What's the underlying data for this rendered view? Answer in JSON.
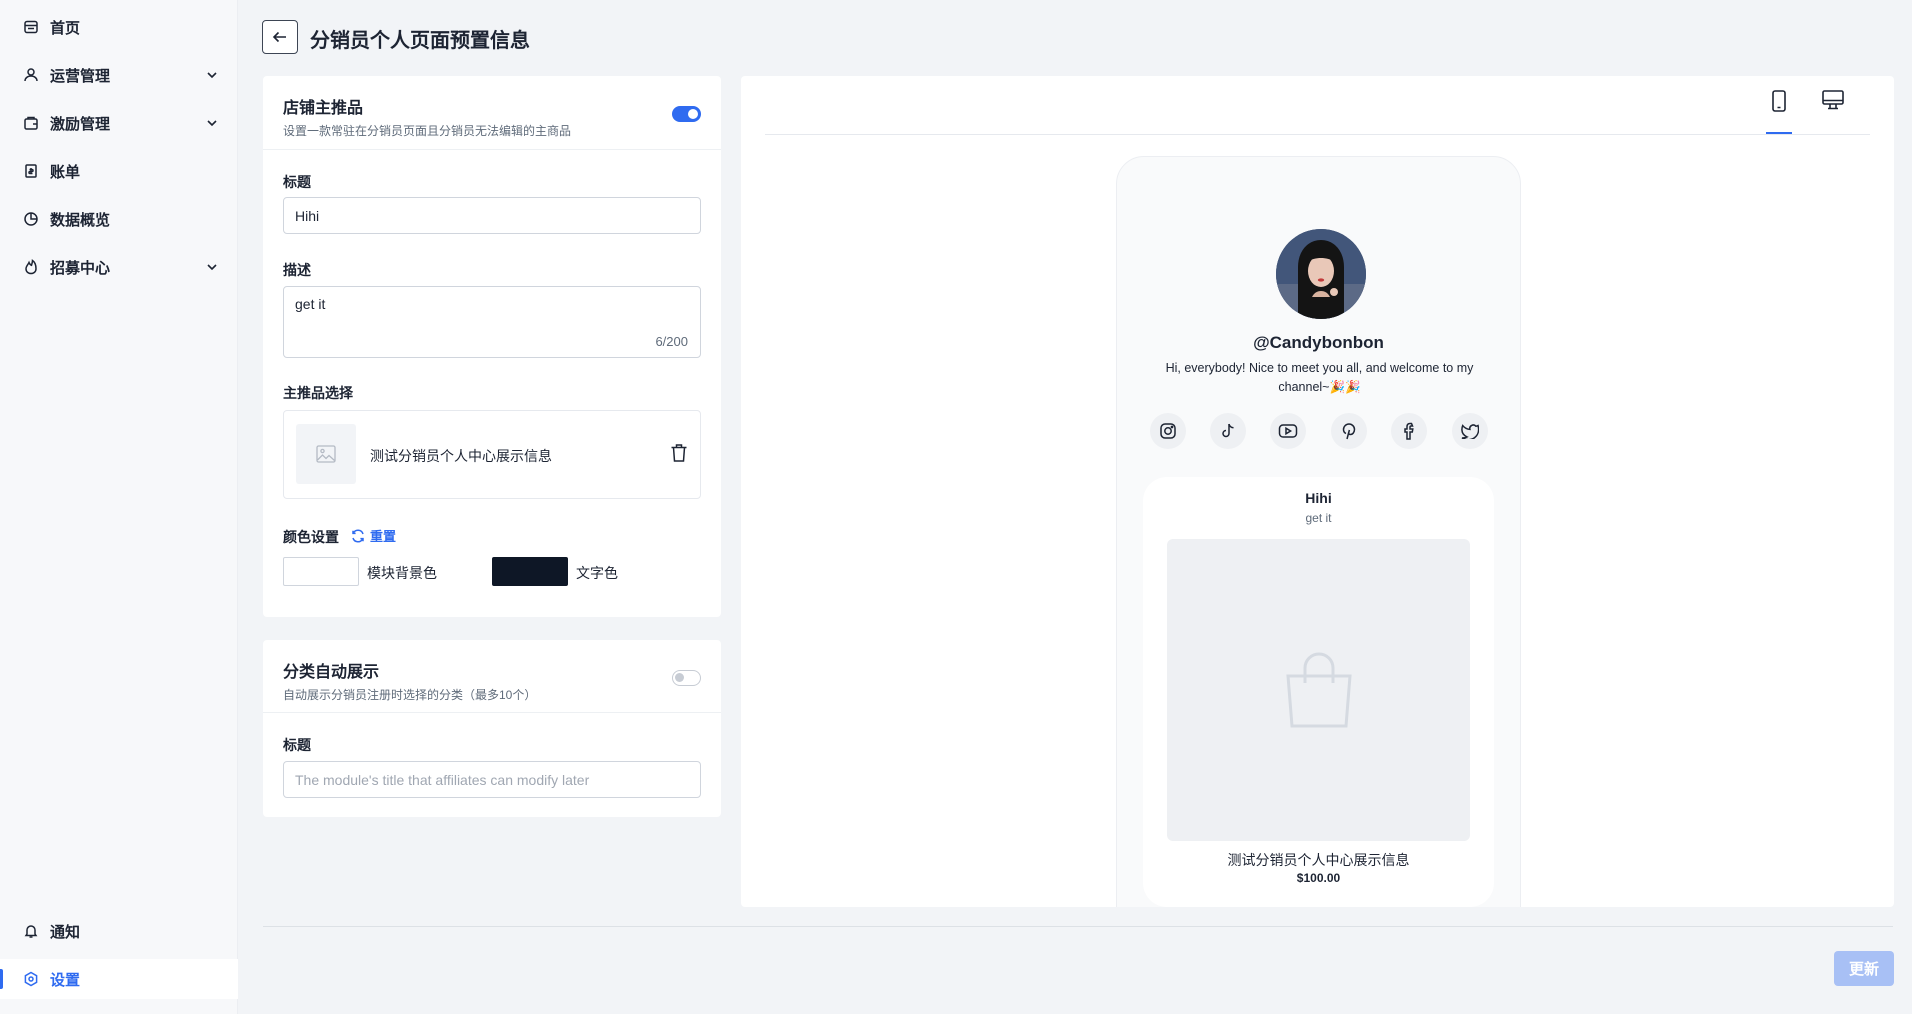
{
  "sidebar": {
    "items": [
      {
        "label": "首页",
        "icon": "store-icon"
      },
      {
        "label": "运营管理",
        "icon": "user-icon",
        "expandable": true
      },
      {
        "label": "激励管理",
        "icon": "wallet-icon",
        "expandable": true
      },
      {
        "label": "账单",
        "icon": "bill-icon"
      },
      {
        "label": "数据概览",
        "icon": "pie-chart-icon"
      },
      {
        "label": "招募中心",
        "icon": "flame-icon",
        "expandable": true
      }
    ],
    "bottom": [
      {
        "label": "通知",
        "icon": "bell-icon"
      },
      {
        "label": "设置",
        "icon": "settings-icon",
        "active": true
      }
    ]
  },
  "header": {
    "title": "分销员个人页面预置信息"
  },
  "featured": {
    "title": "店铺主推品",
    "subtitle": "设置一款常驻在分销员页面且分销员无法编辑的主商品",
    "enabled": true,
    "title_label": "标题",
    "title_value": "Hihi",
    "desc_label": "描述",
    "desc_value": "get it",
    "desc_counter": "6/200",
    "product_label": "主推品选择",
    "product_name": "测试分销员个人中心展示信息",
    "color_label": "颜色设置",
    "reset_label": "重置",
    "bg_color_label": "模块背景色",
    "bg_color": "#ffffff",
    "text_color_label": "文字色",
    "text_color": "#0e1726"
  },
  "category": {
    "title": "分类自动展示",
    "subtitle": "自动展示分销员注册时选择的分类（最多10个）",
    "enabled": false,
    "title_label": "标题",
    "title_placeholder": "The module's title that affiliates can modify later"
  },
  "preview": {
    "tabs": [
      "mobile-icon",
      "desktop-icon"
    ],
    "active_tab": "mobile",
    "username": "@Candybonbon",
    "bio": "Hi, everybody! Nice to meet you all, and welcome to my channel~🎉🎉",
    "socials": [
      "instagram-icon",
      "tiktok-icon",
      "youtube-icon",
      "pinterest-icon",
      "facebook-icon",
      "twitter-icon"
    ],
    "card_title": "Hihi",
    "card_desc": "get it",
    "product_name": "测试分销员个人中心展示信息",
    "product_price": "$100.00"
  },
  "footer": {
    "update_label": "更新"
  }
}
